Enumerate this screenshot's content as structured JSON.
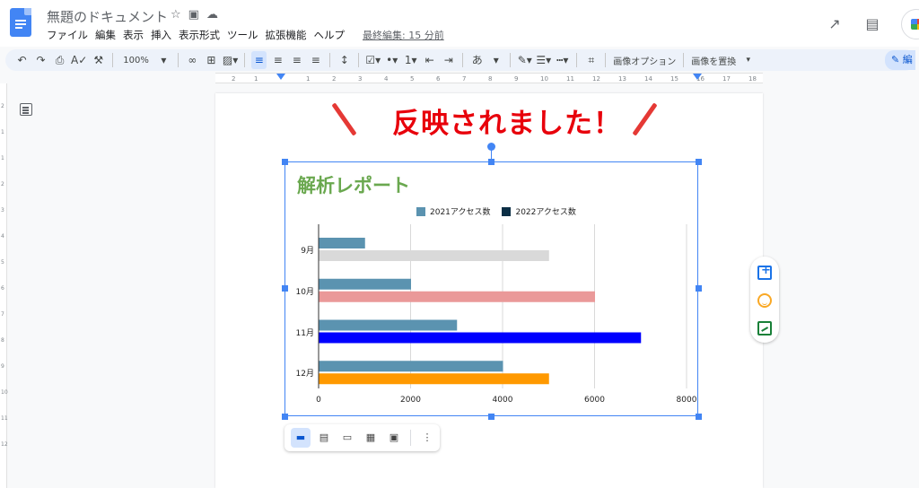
{
  "header": {
    "doc_title": "無題のドキュメント",
    "menu": [
      "ファイル",
      "編集",
      "表示",
      "挿入",
      "表示形式",
      "ツール",
      "拡張機能",
      "ヘルプ"
    ],
    "last_edit": "最終編集: 15 分前"
  },
  "toolbar": {
    "zoom": "100%",
    "ime_label": "あ",
    "image_options_label": "画像オプション",
    "replace_image_label": "画像を置換",
    "edit_mode_label": "編"
  },
  "ruler": {
    "h_ticks": [
      "2",
      "1",
      "1",
      "2",
      "3",
      "4",
      "5",
      "6",
      "7",
      "8",
      "9",
      "10",
      "11",
      "12",
      "13",
      "14",
      "15",
      "16",
      "17",
      "18"
    ],
    "v_ticks": [
      "2",
      "1",
      "1",
      "2",
      "3",
      "4",
      "5",
      "6",
      "7",
      "8",
      "9",
      "10",
      "11",
      "12"
    ]
  },
  "callout": "反映されました！",
  "chart_data": {
    "type": "bar",
    "orientation": "horizontal",
    "title": "解析レポート",
    "title_color": "#6aa84f",
    "categories": [
      "9月",
      "10月",
      "11月",
      "12月"
    ],
    "series": [
      {
        "name": "2021アクセス数",
        "color": "#5b93b0",
        "values": [
          1000,
          2000,
          3000,
          4000
        ]
      },
      {
        "name": "2022アクセス数",
        "color": "#0b2e45",
        "values": [
          5000,
          6000,
          7000,
          5000
        ],
        "bar_colors": [
          "#d9d9d9",
          "#ea9999",
          "#0000ff",
          "#ff9900"
        ]
      }
    ],
    "xlim": [
      0,
      8000
    ],
    "x_ticks": [
      "0",
      "2000",
      "4000",
      "6000",
      "8000"
    ],
    "grid": true,
    "legend_position": "top"
  },
  "image_toolbar": {
    "more_label": "⋮"
  }
}
